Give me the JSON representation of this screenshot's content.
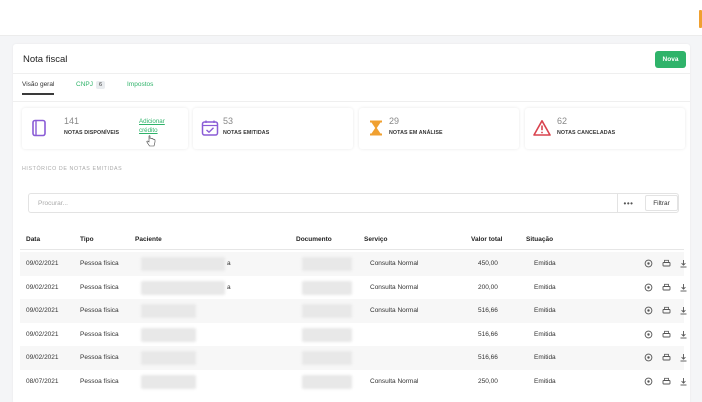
{
  "page": {
    "title": "Nota fiscal",
    "new_button": "Nova"
  },
  "tabs": [
    {
      "label": "Visão geral",
      "active": true
    },
    {
      "label": "CNPJ",
      "badge": "6"
    },
    {
      "label": "Impostos"
    }
  ],
  "stats": [
    {
      "value": "141",
      "label": "NOTAS DISPONÍVEIS",
      "icon": "document-icon",
      "link": "Adicionar crédito",
      "color": "#8a5cd6"
    },
    {
      "value": "53",
      "label": "NOTAS EMITIDAS",
      "icon": "calendar-check-icon",
      "color": "#8a5cd6"
    },
    {
      "value": "29",
      "label": "NOTAS EM ANÁLISE",
      "icon": "hourglass-icon",
      "color": "#f0a030"
    },
    {
      "value": "62",
      "label": "NOTAS CANCELADAS",
      "icon": "warning-icon",
      "color": "#d9434e"
    }
  ],
  "history": {
    "title": "HISTÓRICO DE NOTAS EMITIDAS",
    "search_placeholder": "Procurar...",
    "more_label": "•••",
    "filter_label": "Filtrar"
  },
  "table": {
    "headers": [
      "Data",
      "Tipo",
      "Paciente",
      "Documento",
      "Serviço",
      "Valor total",
      "Situação"
    ],
    "rows": [
      {
        "date": "09/02/2021",
        "type": "Pessoa física",
        "patient_tail": "a",
        "service": "Consulta Normal",
        "value": "450,00",
        "status": "Emitida"
      },
      {
        "date": "09/02/2021",
        "type": "Pessoa física",
        "patient_tail": "a",
        "service": "Consulta Normal",
        "value": "200,00",
        "status": "Emitida"
      },
      {
        "date": "09/02/2021",
        "type": "Pessoa física",
        "patient_tail": "",
        "service": "Consulta Normal",
        "value": "516,66",
        "status": "Emitida"
      },
      {
        "date": "09/02/2021",
        "type": "Pessoa física",
        "patient_tail": "",
        "service": "",
        "value": "516,66",
        "status": "Emitida"
      },
      {
        "date": "09/02/2021",
        "type": "Pessoa física",
        "patient_tail": "",
        "service": "",
        "value": "516,66",
        "status": "Emitida"
      },
      {
        "date": "08/07/2021",
        "type": "Pessoa física",
        "patient_tail": "",
        "service": "Consulta Normal",
        "value": "250,00",
        "status": "Emitida"
      }
    ]
  },
  "colors": {
    "accent_green": "#2fb36a",
    "purple": "#8a5cd6",
    "orange": "#f0a030",
    "red": "#d9434e"
  }
}
